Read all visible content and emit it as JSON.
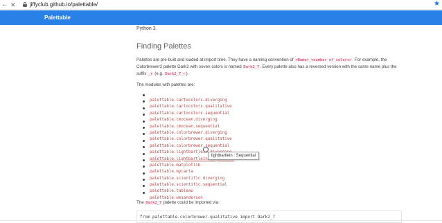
{
  "browser": {
    "url": "jiffyclub.github.io/palettable/"
  },
  "header": {
    "brand": "Palettable"
  },
  "content": {
    "python_line": "Python 3.",
    "heading": "Finding Palettes",
    "para1": {
      "t1": "Palettes are pre-built and loaded at import time. They have a naming convention of ",
      "c1": "<Name>_<number of colors>",
      "t2": ". For example, the Colorbrewer2 palette Dark2 with seven colors is named ",
      "c2": "Dark2_7",
      "t3": ". Every palette also has a reversed version with the same name plus the suffix ",
      "c3": "_r",
      "t4": " (e.g. ",
      "c4": "Dark2_7_r",
      "t5": ")."
    },
    "para2": "The modules with palettes are:",
    "modules": [
      "palettable.cartocolors.diverging",
      "palettable.cartocolors.qualitative",
      "palettable.cartocolors.sequential",
      "palettable.cmocean.diverging",
      "palettable.cmocean.sequential",
      "palettable.colorbrewer.diverging",
      "palettable.colorbrewer.qualitative",
      "palettable.colorbrewer.sequential",
      "palettable.lightbartlein.diverging",
      "palettable.lightbartlein.sequential",
      "palettable.matplotlib",
      "palettable.mycarta",
      "palettable.scientific.diverging",
      "palettable.scientific.sequential",
      "palettable.tableau",
      "palettable.wesanderson"
    ],
    "tooltip": "lightbartlein : Sequential",
    "import_para": {
      "t1": "The ",
      "c1": "Dark2_7",
      "t2": " palette could be imported via:"
    },
    "code": "from palettable.colorbrewer.qualitative import Dark2_7"
  },
  "colors": {
    "header_bg": "#2980e6",
    "link": "#b04a4a",
    "code_inline": "#c7254e"
  }
}
